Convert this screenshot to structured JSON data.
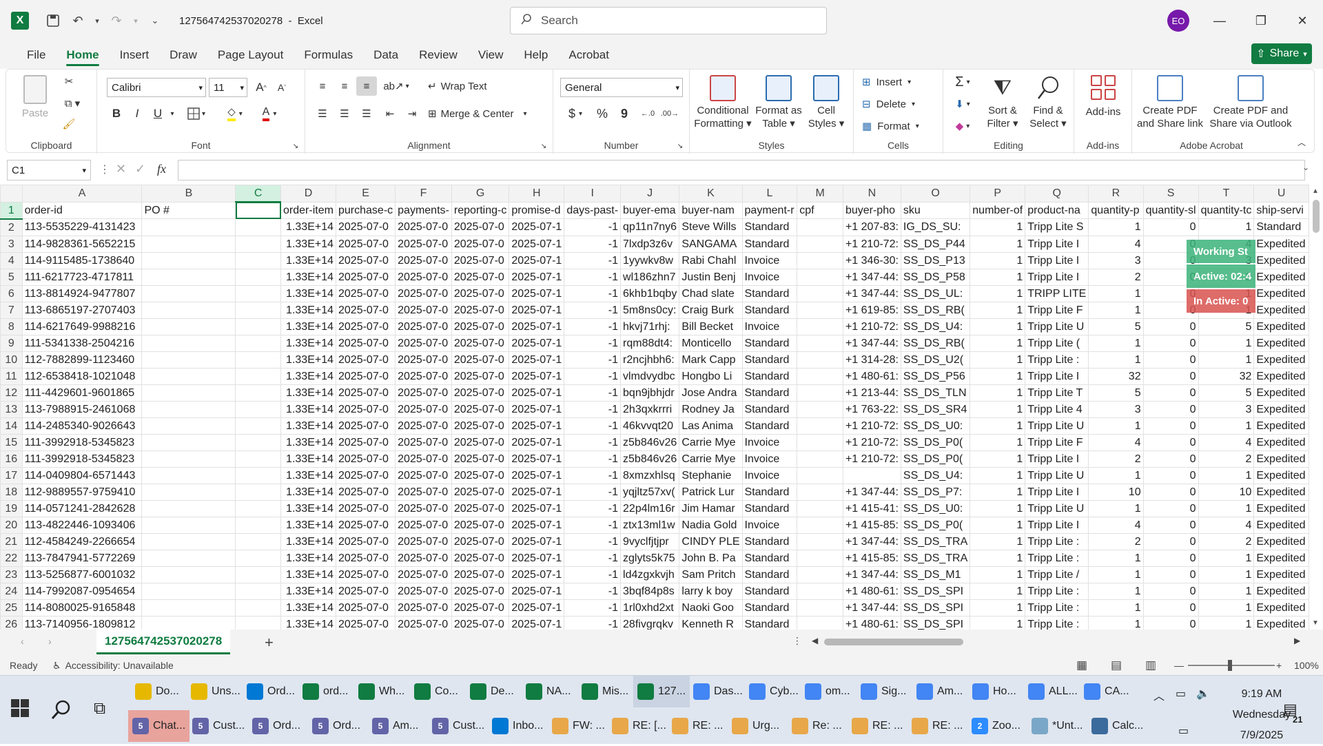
{
  "window": {
    "file_name": "127564742537020278",
    "app_name": "Excel",
    "title_sep": "-",
    "search_placeholder": "Search",
    "avatar_initials": "EO"
  },
  "menu": [
    "File",
    "Home",
    "Insert",
    "Draw",
    "Page Layout",
    "Formulas",
    "Data",
    "Review",
    "View",
    "Help",
    "Acrobat"
  ],
  "share_label": "Share",
  "ribbon": {
    "clipboard": {
      "paste": "Paste",
      "label": "Clipboard"
    },
    "font": {
      "name": "Calibri",
      "size": "11",
      "label": "Font",
      "bold": "B",
      "italic": "I",
      "underline": "U"
    },
    "alignment": {
      "wrap": "Wrap Text",
      "merge": "Merge & Center",
      "label": "Alignment"
    },
    "number": {
      "format": "General",
      "currency": "$",
      "percent": "%",
      "comma": "9",
      "label": "Number"
    },
    "styles": {
      "cond_line1": "Conditional",
      "cond_line2": "Formatting",
      "table_line1": "Format as",
      "table_line2": "Table",
      "cell_line1": "Cell",
      "cell_line2": "Styles",
      "label": "Styles"
    },
    "cells": {
      "insert": "Insert",
      "delete": "Delete",
      "format": "Format",
      "label": "Cells"
    },
    "editing": {
      "sort_line1": "Sort &",
      "sort_line2": "Filter",
      "find_line1": "Find &",
      "find_line2": "Select",
      "label": "Editing"
    },
    "addins": {
      "btn": "Add-ins",
      "label": "Add-ins"
    },
    "acrobat": {
      "pdf1_line1": "Create PDF",
      "pdf1_line2": "and Share link",
      "pdf2_line1": "Create PDF and",
      "pdf2_line2": "Share via Outlook",
      "label": "Adobe Acrobat"
    }
  },
  "name_box": "C1",
  "fx": "fx",
  "columns": [
    "A",
    "B",
    "C",
    "D",
    "E",
    "F",
    "G",
    "H",
    "I",
    "J",
    "K",
    "L",
    "M",
    "N",
    "O",
    "P",
    "Q",
    "R",
    "S",
    "T",
    "U"
  ],
  "header_row": [
    "order-id",
    "PO #",
    "",
    "order-item",
    "purchase-c",
    "payments-",
    "reporting-c",
    "promise-d",
    "days-past-",
    "buyer-ema",
    "buyer-nam",
    "payment-r",
    "cpf",
    "buyer-pho",
    "sku",
    "number-of",
    "product-na",
    "quantity-p",
    "quantity-sl",
    "quantity-tc",
    "ship-servi"
  ],
  "rows": [
    [
      "113-5535229-4131423",
      "",
      "",
      "1.33E+14",
      "2025-07-0",
      "2025-07-0",
      "2025-07-0",
      "2025-07-1",
      "-1",
      "qp11n7ny6",
      "Steve Wills",
      "Standard",
      "",
      "+1 207-83:",
      "IG_DS_SU:",
      "1",
      "Tripp Lite S",
      "1",
      "0",
      "1",
      "Standard"
    ],
    [
      "114-9828361-5652215",
      "",
      "",
      "1.33E+14",
      "2025-07-0",
      "2025-07-0",
      "2025-07-0",
      "2025-07-1",
      "-1",
      "7lxdp3z6v",
      "SANGAMA",
      "Standard",
      "",
      "+1 210-72:",
      "SS_DS_P44",
      "1",
      "Tripp Lite I",
      "4",
      "0",
      "4",
      "Expedited"
    ],
    [
      "114-9115485-1738640",
      "",
      "",
      "1.33E+14",
      "2025-07-0",
      "2025-07-0",
      "2025-07-0",
      "2025-07-1",
      "-1",
      "1yywkv8w",
      "Rabi Chahl",
      "Invoice",
      "",
      "+1 346-30:",
      "SS_DS_P13",
      "1",
      "Tripp Lite I",
      "3",
      "0",
      "3",
      "Expedited"
    ],
    [
      "111-6217723-4717811",
      "",
      "",
      "1.33E+14",
      "2025-07-0",
      "2025-07-0",
      "2025-07-0",
      "2025-07-1",
      "-1",
      "wl186zhn7",
      "Justin Benj",
      "Invoice",
      "",
      "+1 347-44:",
      "SS_DS_P58",
      "1",
      "Tripp Lite I",
      "2",
      "0",
      "2",
      "Expedited"
    ],
    [
      "113-8814924-9477807",
      "",
      "",
      "1.33E+14",
      "2025-07-0",
      "2025-07-0",
      "2025-07-0",
      "2025-07-1",
      "-1",
      "6khb1bqby",
      "Chad slate",
      "Standard",
      "",
      "+1 347-44:",
      "SS_DS_UL:",
      "1",
      "TRIPP LITE",
      "1",
      "0",
      "1",
      "Expedited"
    ],
    [
      "113-6865197-2707403",
      "",
      "",
      "1.33E+14",
      "2025-07-0",
      "2025-07-0",
      "2025-07-0",
      "2025-07-1",
      "-1",
      "5m8ns0cy:",
      "Craig Burk",
      "Standard",
      "",
      "+1 619-85:",
      "SS_DS_RB(",
      "1",
      "Tripp Lite F",
      "1",
      "0",
      "1",
      "Expedited"
    ],
    [
      "114-6217649-9988216",
      "",
      "",
      "1.33E+14",
      "2025-07-0",
      "2025-07-0",
      "2025-07-0",
      "2025-07-1",
      "-1",
      "hkvj71rhj:",
      "Bill Becket",
      "Invoice",
      "",
      "+1 210-72:",
      "SS_DS_U4:",
      "1",
      "Tripp Lite U",
      "5",
      "0",
      "5",
      "Expedited"
    ],
    [
      "111-5341338-2504216",
      "",
      "",
      "1.33E+14",
      "2025-07-0",
      "2025-07-0",
      "2025-07-0",
      "2025-07-1",
      "-1",
      "rqm88dt4:",
      "Monticello",
      "Standard",
      "",
      "+1 347-44:",
      "SS_DS_RB(",
      "1",
      "Tripp Lite (",
      "1",
      "0",
      "1",
      "Expedited"
    ],
    [
      "112-7882899-1123460",
      "",
      "",
      "1.33E+14",
      "2025-07-0",
      "2025-07-0",
      "2025-07-0",
      "2025-07-1",
      "-1",
      "r2ncjhbh6:",
      "Mark Capp",
      "Standard",
      "",
      "+1 314-28:",
      "SS_DS_U2(",
      "1",
      "Tripp Lite :",
      "1",
      "0",
      "1",
      "Expedited"
    ],
    [
      "112-6538418-1021048",
      "",
      "",
      "1.33E+14",
      "2025-07-0",
      "2025-07-0",
      "2025-07-0",
      "2025-07-1",
      "-1",
      "vlmdvydbc",
      "Hongbo Li",
      "Standard",
      "",
      "+1 480-61:",
      "SS_DS_P56",
      "1",
      "Tripp Lite I",
      "32",
      "0",
      "32",
      "Expedited"
    ],
    [
      "111-4429601-9601865",
      "",
      "",
      "1.33E+14",
      "2025-07-0",
      "2025-07-0",
      "2025-07-0",
      "2025-07-1",
      "-1",
      "bqn9jbhjdr",
      "Jose Andra",
      "Standard",
      "",
      "+1 213-44:",
      "SS_DS_TLN",
      "1",
      "Tripp Lite T",
      "5",
      "0",
      "5",
      "Expedited"
    ],
    [
      "113-7988915-2461068",
      "",
      "",
      "1.33E+14",
      "2025-07-0",
      "2025-07-0",
      "2025-07-0",
      "2025-07-1",
      "-1",
      "2h3qxkrrri",
      "Rodney Ja",
      "Standard",
      "",
      "+1 763-22:",
      "SS_DS_SR4",
      "1",
      "Tripp Lite 4",
      "3",
      "0",
      "3",
      "Expedited"
    ],
    [
      "114-2485340-9026643",
      "",
      "",
      "1.33E+14",
      "2025-07-0",
      "2025-07-0",
      "2025-07-0",
      "2025-07-1",
      "-1",
      "46kvvqt20",
      "Las Anima",
      "Standard",
      "",
      "+1 210-72:",
      "SS_DS_U0:",
      "1",
      "Tripp Lite U",
      "1",
      "0",
      "1",
      "Expedited"
    ],
    [
      "111-3992918-5345823",
      "",
      "",
      "1.33E+14",
      "2025-07-0",
      "2025-07-0",
      "2025-07-0",
      "2025-07-1",
      "-1",
      "z5b846v26",
      "Carrie Mye",
      "Invoice",
      "",
      "+1 210-72:",
      "SS_DS_P0(",
      "1",
      "Tripp Lite F",
      "4",
      "0",
      "4",
      "Expedited"
    ],
    [
      "111-3992918-5345823",
      "",
      "",
      "1.33E+14",
      "2025-07-0",
      "2025-07-0",
      "2025-07-0",
      "2025-07-1",
      "-1",
      "z5b846v26",
      "Carrie Mye",
      "Invoice",
      "",
      "+1 210-72:",
      "SS_DS_P0(",
      "1",
      "Tripp Lite I",
      "2",
      "0",
      "2",
      "Expedited"
    ],
    [
      "114-0409804-6571443",
      "",
      "",
      "1.33E+14",
      "2025-07-0",
      "2025-07-0",
      "2025-07-0",
      "2025-07-1",
      "-1",
      "8xmzxhlsq",
      "Stephanie",
      "Invoice",
      "",
      "",
      "SS_DS_U4:",
      "1",
      "Tripp Lite U",
      "1",
      "0",
      "1",
      "Expedited"
    ],
    [
      "112-9889557-9759410",
      "",
      "",
      "1.33E+14",
      "2025-07-0",
      "2025-07-0",
      "2025-07-0",
      "2025-07-1",
      "-1",
      "yqjltz57xv(",
      "Patrick Lur",
      "Standard",
      "",
      "+1 347-44:",
      "SS_DS_P7:",
      "1",
      "Tripp Lite I",
      "10",
      "0",
      "10",
      "Expedited"
    ],
    [
      "114-0571241-2842628",
      "",
      "",
      "1.33E+14",
      "2025-07-0",
      "2025-07-0",
      "2025-07-0",
      "2025-07-1",
      "-1",
      "22p4lm16r",
      "Jim Hamar",
      "Standard",
      "",
      "+1 415-41:",
      "SS_DS_U0:",
      "1",
      "Tripp Lite U",
      "1",
      "0",
      "1",
      "Expedited"
    ],
    [
      "113-4822446-1093406",
      "",
      "",
      "1.33E+14",
      "2025-07-0",
      "2025-07-0",
      "2025-07-0",
      "2025-07-1",
      "-1",
      "ztx13ml1w",
      "Nadia Gold",
      "Invoice",
      "",
      "+1 415-85:",
      "SS_DS_P0(",
      "1",
      "Tripp Lite I",
      "4",
      "0",
      "4",
      "Expedited"
    ],
    [
      "112-4584249-2266654",
      "",
      "",
      "1.33E+14",
      "2025-07-0",
      "2025-07-0",
      "2025-07-0",
      "2025-07-1",
      "-1",
      "9vyclfjtjpr",
      "CINDY PLE",
      "Standard",
      "",
      "+1 347-44:",
      "SS_DS_TRA",
      "1",
      "Tripp Lite :",
      "2",
      "0",
      "2",
      "Expedited"
    ],
    [
      "113-7847941-5772269",
      "",
      "",
      "1.33E+14",
      "2025-07-0",
      "2025-07-0",
      "2025-07-0",
      "2025-07-1",
      "-1",
      "zglyts5k75",
      "John B. Pa",
      "Standard",
      "",
      "+1 415-85:",
      "SS_DS_TRA",
      "1",
      "Tripp Lite :",
      "1",
      "0",
      "1",
      "Expedited"
    ],
    [
      "113-5256877-6001032",
      "",
      "",
      "1.33E+14",
      "2025-07-0",
      "2025-07-0",
      "2025-07-0",
      "2025-07-1",
      "-1",
      "ld4zgxkvjh",
      "Sam Pritch",
      "Standard",
      "",
      "+1 347-44:",
      "SS_DS_M1",
      "1",
      "Tripp Lite /",
      "1",
      "0",
      "1",
      "Expedited"
    ],
    [
      "114-7992087-0954654",
      "",
      "",
      "1.33E+14",
      "2025-07-0",
      "2025-07-0",
      "2025-07-0",
      "2025-07-1",
      "-1",
      "3bqf84p8s",
      "larry k boy",
      "Standard",
      "",
      "+1 480-61:",
      "SS_DS_SPI",
      "1",
      "Tripp Lite :",
      "1",
      "0",
      "1",
      "Expedited"
    ],
    [
      "114-8080025-9165848",
      "",
      "",
      "1.33E+14",
      "2025-07-0",
      "2025-07-0",
      "2025-07-0",
      "2025-07-1",
      "-1",
      "1rl0xhd2xt",
      "Naoki Goo",
      "Standard",
      "",
      "+1 347-44:",
      "SS_DS_SPI",
      "1",
      "Tripp Lite :",
      "1",
      "0",
      "1",
      "Expedited"
    ],
    [
      "113-7140956-1809812",
      "",
      "",
      "1.33E+14",
      "2025-07-0",
      "2025-07-0",
      "2025-07-0",
      "2025-07-1",
      "-1",
      "28fivgrqkv",
      "Kenneth R",
      "Standard",
      "",
      "+1 480-61:",
      "SS_DS_SPI",
      "1",
      "Tripp Lite :",
      "1",
      "0",
      "1",
      "Expedited"
    ]
  ],
  "overlay": [
    "Working St",
    "Active: 02:4",
    "In Active: 0"
  ],
  "sheet_tab": "127564742537020278",
  "status": {
    "ready": "Ready",
    "accessibility": "Accessibility: Unavailable",
    "zoom": "100%"
  },
  "taskbar_top": [
    "Do...",
    "Uns...",
    "Ord...",
    "ord...",
    "Wh...",
    "Co...",
    "De...",
    "NA...",
    "Mis...",
    "127...",
    "Das...",
    "Cyb...",
    "om...",
    "Sig...",
    "Am...",
    "Ho...",
    "ALL...",
    "CA..."
  ],
  "taskbar_bottom": [
    "Chat...",
    "Cust...",
    "Ord...",
    "Ord...",
    "Am...",
    "Cust...",
    "Inbo...",
    "FW: ...",
    "RE: [...",
    "RE: ...",
    "Urg...",
    "Re: ...",
    "RE: ...",
    "RE: ...",
    "Zoo...",
    "*Unt...",
    "Calc..."
  ],
  "badges": {
    "chat": "5",
    "zoom": "2",
    "notif": "21"
  },
  "clock": {
    "time": "9:19 AM",
    "day": "Wednesday",
    "date": "7/9/2025"
  }
}
